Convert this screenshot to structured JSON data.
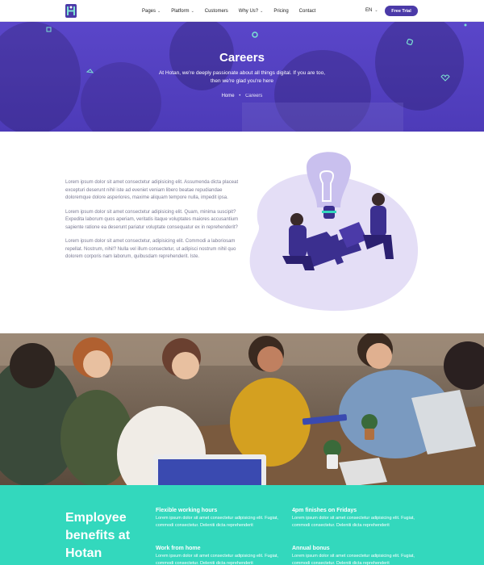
{
  "nav": {
    "items": [
      {
        "label": "Pages",
        "dropdown": true
      },
      {
        "label": "Platform",
        "dropdown": true
      },
      {
        "label": "Customers",
        "dropdown": false
      },
      {
        "label": "Why Us?",
        "dropdown": true
      },
      {
        "label": "Pricing",
        "dropdown": false
      },
      {
        "label": "Contact",
        "dropdown": false
      }
    ],
    "language": "EN",
    "cta_label": "Free Trial"
  },
  "hero": {
    "title": "Careers",
    "subtitle": "At Hotan, we're deeply passionate about all things digital. If you are too, then we're glad you're here",
    "breadcrumb_home": "Home",
    "breadcrumb_separator": "•",
    "breadcrumb_current": "Careers"
  },
  "about": {
    "paragraphs": [
      "Lorem ipsum dolor sit amet consectetur adipisicing elit. Assumenda dicta placeat excepturi deserunt nihil iste ad eveniet veniam libero beatae repudiandae doloremque dolore asperiores, maxime aliquam tempore nulla, impedit ipsa.",
      "Lorem ipsum dolor sit amet consectetur adipisicing elit. Quam, minima suscipit? Expedita laborum quos aperiam, veritatis itaque voluptates maiores accusantium sapiente ratione ea deserunt pariatur voluptate consequatur ex in reprehenderit?",
      "Lorem ipsum dolor sit amet consectetur, adipisicing elit. Commodi a laboriosam repellat. Nostrum, nihil? Nulla vel illum consectetur, ut adipisci nostrum nihil quo dolorem corporis nam laborum, quibusdam reprehenderit. Iste."
    ]
  },
  "benefits": {
    "title": "Employee benefits at Hotan",
    "items": [
      {
        "title": "Flexible working hours",
        "text": "Lorem ipsum dolor sit amet consectetur adipisicing elit. Fugiat, commodi consectetur. Deleniti dicta reprehenderit"
      },
      {
        "title": "4pm finishes on Fridays",
        "text": "Lorem ipsum dolor sit amet consectetur adipisicing elit. Fugiat, commodi consectetur. Deleniti dicta reprehenderit"
      },
      {
        "title": "Work from home",
        "text": "Lorem ipsum dolor sit amet consectetur adipisicing elit. Fugiat, commodi consectetur. Deleniti dicta reprehenderit"
      },
      {
        "title": "Annual bonus",
        "text": "Lorem ipsum dolor sit amet consectetur adipisicing elit. Fugiat, commodi consectetur. Deleniti dicta reprehenderit"
      }
    ]
  },
  "colors": {
    "brand_purple": "#4b3aa8",
    "hero_purple": "#5a46c9",
    "teal": "#33d8bd",
    "illustration_lavender": "#e4def6"
  },
  "icons": {
    "logo": "hotan-logo-icon",
    "dropdown": "chevron-down-icon"
  }
}
